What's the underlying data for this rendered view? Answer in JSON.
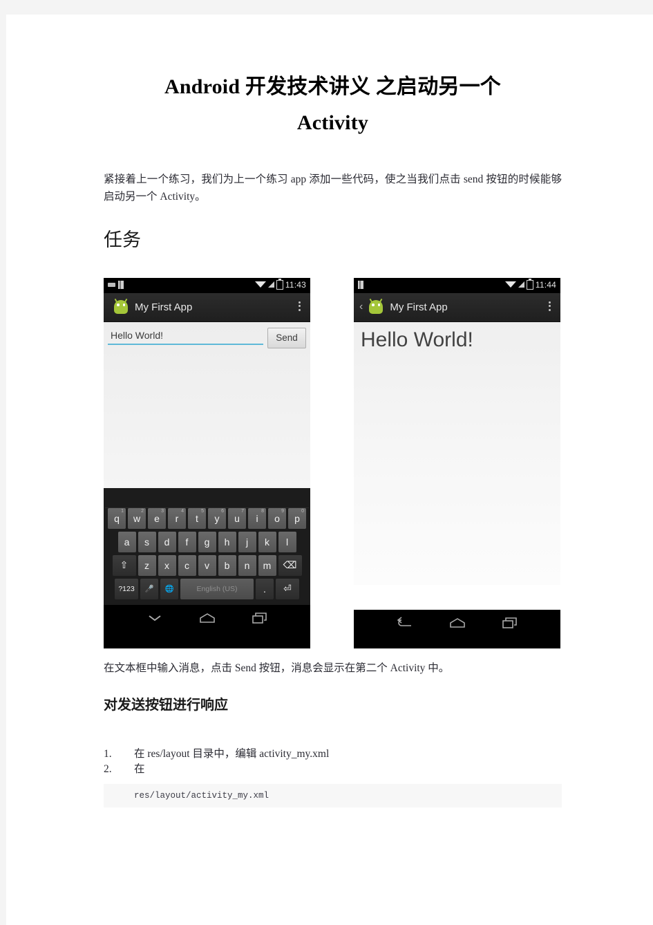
{
  "document": {
    "title_line1": "Android 开发技术讲义 之启动另一个",
    "title_line2": "Activity",
    "intro_paragraph": "紧接着上一个练习，我们为上一个练习 app 添加一些代码，使之当我们点击 send 按钮的时候能够启动另一个 Activity。",
    "section_task_heading": "任务",
    "figure_caption": "在文本框中输入消息，点击 Send 按钮，消息会显示在第二个 Activity 中。",
    "section_respond_heading": "对发送按钮进行响应",
    "steps": [
      {
        "num": "1.",
        "text": "在 res/layout 目录中，编辑 activity_my.xml"
      },
      {
        "num": "2.",
        "text": "在"
      }
    ],
    "code_block": "res/layout/activity_my.xml"
  },
  "figure_phone_a": {
    "status_bar": {
      "time": "11:43"
    },
    "action_bar": {
      "app_title": "My First App"
    },
    "edit_text_value": "Hello World!",
    "send_button_label": "Send",
    "keyboard": {
      "row1": [
        {
          "key": "q",
          "hint": "1"
        },
        {
          "key": "w",
          "hint": "2"
        },
        {
          "key": "e",
          "hint": "3"
        },
        {
          "key": "r",
          "hint": "4"
        },
        {
          "key": "t",
          "hint": "5"
        },
        {
          "key": "y",
          "hint": "6"
        },
        {
          "key": "u",
          "hint": "7"
        },
        {
          "key": "i",
          "hint": "8"
        },
        {
          "key": "o",
          "hint": "9"
        },
        {
          "key": "p",
          "hint": "0"
        }
      ],
      "row2": [
        "a",
        "s",
        "d",
        "f",
        "g",
        "h",
        "j",
        "k",
        "l"
      ],
      "row3_shift": "⇧",
      "row3": [
        "z",
        "x",
        "c",
        "v",
        "b",
        "n",
        "m"
      ],
      "row3_backspace": "⌫",
      "row4_symbols": "?123",
      "row4_mic": "🎤",
      "row4_globe": "🌐",
      "row4_space_label": "English (US)",
      "row4_period": ".",
      "row4_enter": "⏎"
    },
    "nav_bar": {
      "hide_keyboard": "hide-keyboard",
      "home": "home",
      "recents": "recents"
    }
  },
  "figure_phone_b": {
    "status_bar": {
      "time": "11:44"
    },
    "action_bar": {
      "app_title": "My First App",
      "back_chevron": "‹"
    },
    "message_text": "Hello World!",
    "nav_bar": {
      "back": "back",
      "home": "home",
      "recents": "recents"
    }
  },
  "colors": {
    "page_background": "#ffffff",
    "gutter": "#f4f4f4",
    "body_text": "#2b2b33",
    "heading_text": "#1a1a1a",
    "code_background": "#f7f7f7",
    "android_green": "#a4c639",
    "edittext_underline": "#5fb9d8",
    "phone_chrome": "#000000"
  }
}
